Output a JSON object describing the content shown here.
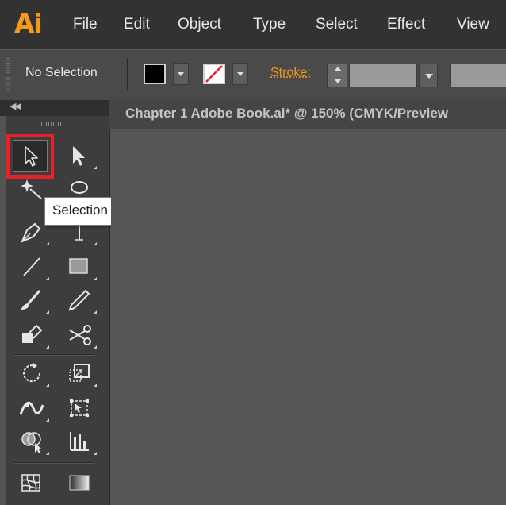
{
  "app": {
    "logo": "Ai"
  },
  "menu": {
    "items": [
      "File",
      "Edit",
      "Object",
      "Type",
      "Select",
      "Effect",
      "View"
    ]
  },
  "control_bar": {
    "selection_status": "No Selection",
    "stroke_label": "Stroke:",
    "fill_color": "#000000",
    "stroke_color": "none"
  },
  "document": {
    "tab_title": "Chapter 1 Adobe Book.ai* @ 150% (CMYK/Preview"
  },
  "tooltip": {
    "text": "Selection Tool (V)"
  },
  "colors": {
    "accent": "#f29a1c",
    "highlight": "#e8202a",
    "canvas": "#555555"
  },
  "tools": [
    "selection-tool-icon",
    "direct-selection-tool-icon",
    "magic-wand-tool-icon",
    "lasso-tool-icon",
    "pen-tool-icon",
    "type-tool-icon",
    "line-segment-tool-icon",
    "rectangle-tool-icon",
    "paintbrush-tool-icon",
    "pencil-tool-icon",
    "eraser-tool-icon",
    "scissors-tool-icon",
    "rotate-tool-icon",
    "scale-tool-icon",
    "width-tool-icon",
    "free-transform-tool-icon",
    "shape-builder-tool-icon",
    "graph-tool-icon",
    "mesh-tool-icon",
    "gradient-tool-icon"
  ]
}
